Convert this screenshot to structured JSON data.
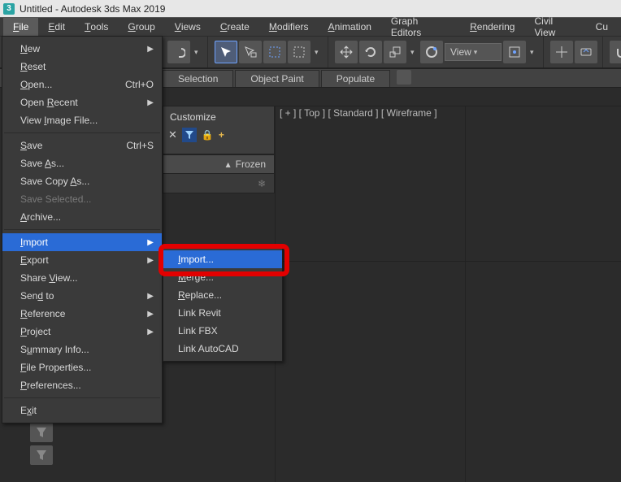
{
  "title": "Untitled - Autodesk 3ds Max 2019",
  "app_icon_char": "3",
  "menubar": [
    "File",
    "Edit",
    "Tools",
    "Group",
    "Views",
    "Create",
    "Modifiers",
    "Animation",
    "Graph Editors",
    "Rendering",
    "Civil View",
    "Cu"
  ],
  "menubar_underline_idx": [
    0,
    0,
    0,
    0,
    0,
    0,
    0,
    0,
    null,
    0,
    null,
    null
  ],
  "menubar_open": 0,
  "tool_select_label": "View",
  "tabs": {
    "selection": "Selection",
    "object_paint": "Object Paint",
    "populate": "Populate"
  },
  "scene": {
    "customize": "Customize",
    "frozen_label": "Frozen",
    "frozen_tri": "▴",
    "snow": "❄"
  },
  "viewport_label": "[ + ] [ Top ] [ Standard ] [ Wireframe ]",
  "file_menu": [
    {
      "label": "New",
      "u": 0,
      "submenu": true
    },
    {
      "label": "Reset",
      "u": 0
    },
    {
      "label": "Open...",
      "u": 0,
      "accel": "Ctrl+O"
    },
    {
      "label": "Open Recent",
      "u": 5,
      "submenu": true
    },
    {
      "label": "View Image File...",
      "u": 5
    },
    {
      "sep": true
    },
    {
      "label": "Save",
      "u": 0,
      "accel": "Ctrl+S"
    },
    {
      "label": "Save As...",
      "u": 5
    },
    {
      "label": "Save Copy As...",
      "u": 10
    },
    {
      "label": "Save Selected...",
      "disabled": true
    },
    {
      "label": "Archive...",
      "u": 0
    },
    {
      "sep": true
    },
    {
      "label": "Import",
      "u": 0,
      "submenu": true,
      "hi": true
    },
    {
      "label": "Export",
      "u": 0,
      "submenu": true
    },
    {
      "label": "Share View...",
      "u": 6
    },
    {
      "label": "Send to",
      "u": 3,
      "submenu": true
    },
    {
      "label": "Reference",
      "u": 0,
      "submenu": true
    },
    {
      "label": "Project",
      "u": 0,
      "submenu": true
    },
    {
      "label": "Summary Info...",
      "u": 1
    },
    {
      "label": "File Properties...",
      "u": 0
    },
    {
      "label": "Preferences...",
      "u": 0
    },
    {
      "sep": true
    },
    {
      "label": "Exit",
      "u": 1
    }
  ],
  "import_submenu": [
    {
      "label": "Import...",
      "u": 0,
      "hi": true
    },
    {
      "label": "Merge...",
      "u": 0
    },
    {
      "label": "Replace...",
      "u": 0
    },
    {
      "label": "Link Revit"
    },
    {
      "label": "Link FBX"
    },
    {
      "label": "Link AutoCAD"
    }
  ]
}
